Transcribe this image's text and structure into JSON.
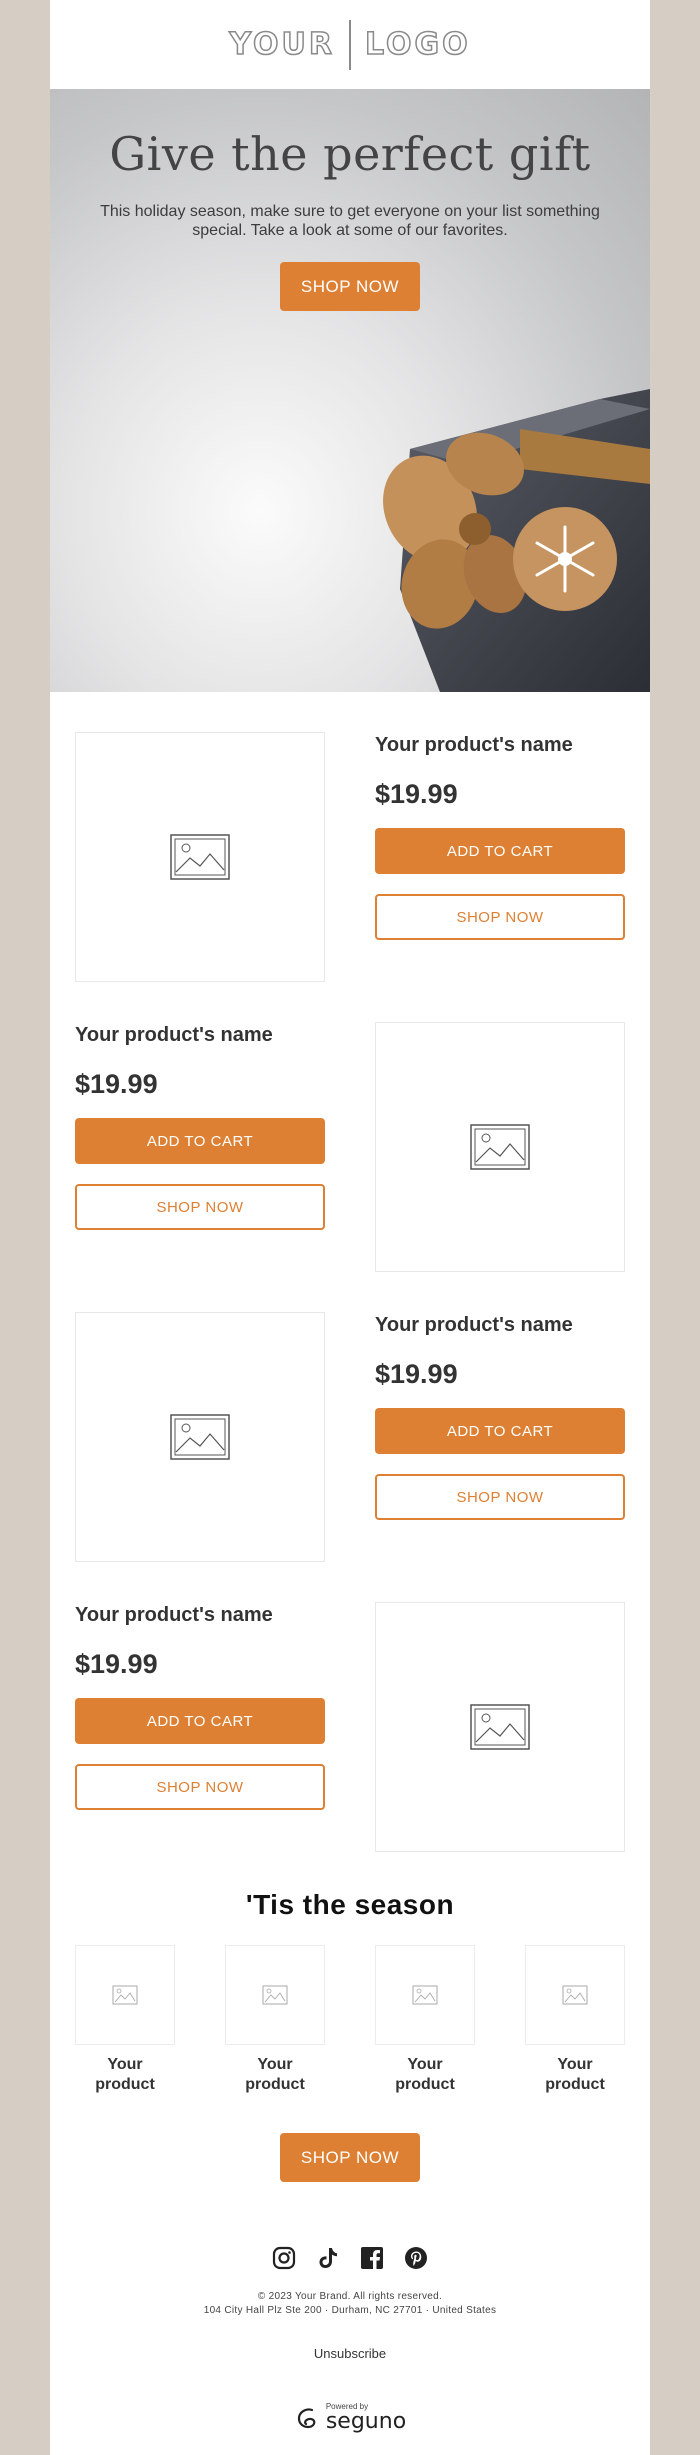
{
  "header": {
    "logo_left": "YOUR",
    "logo_right": "LOGO"
  },
  "hero": {
    "title": "Give the perfect gift",
    "text": "This holiday season, make sure to get everyone on your list something special. Take a look at some of our favorites.",
    "button": "SHOP NOW"
  },
  "products": [
    {
      "name": "Your product's name",
      "price": "$19.99",
      "cart": "ADD TO CART",
      "shop": "SHOP NOW"
    },
    {
      "name": "Your product's name",
      "price": "$19.99",
      "cart": "ADD TO CART",
      "shop": "SHOP NOW"
    },
    {
      "name": "Your product's name",
      "price": "$19.99",
      "cart": "ADD TO CART",
      "shop": "SHOP NOW"
    },
    {
      "name": "Your product's name",
      "price": "$19.99",
      "cart": "ADD TO CART",
      "shop": "SHOP NOW"
    }
  ],
  "season": {
    "title": "'Tis the season",
    "items": [
      {
        "l1": "Your",
        "l2": "product"
      },
      {
        "l1": "Your",
        "l2": "product"
      },
      {
        "l1": "Your",
        "l2": "product"
      },
      {
        "l1": "Your",
        "l2": "product"
      }
    ],
    "button": "SHOP NOW"
  },
  "footer": {
    "social_icons": [
      "instagram-icon",
      "tiktok-icon",
      "facebook-icon",
      "pinterest-icon"
    ],
    "copyright": "© 2023 Your Brand. All rights reserved.",
    "address": "104 City Hall Plz Ste 200 · Durham, NC 27701 · United States",
    "unsubscribe": "Unsubscribe",
    "powered_by": "Powered by",
    "powered_brand": "seguno"
  },
  "colors": {
    "accent": "#dd8033",
    "page_bg": "#d6cdc4",
    "card_bg": "#ffffff"
  }
}
